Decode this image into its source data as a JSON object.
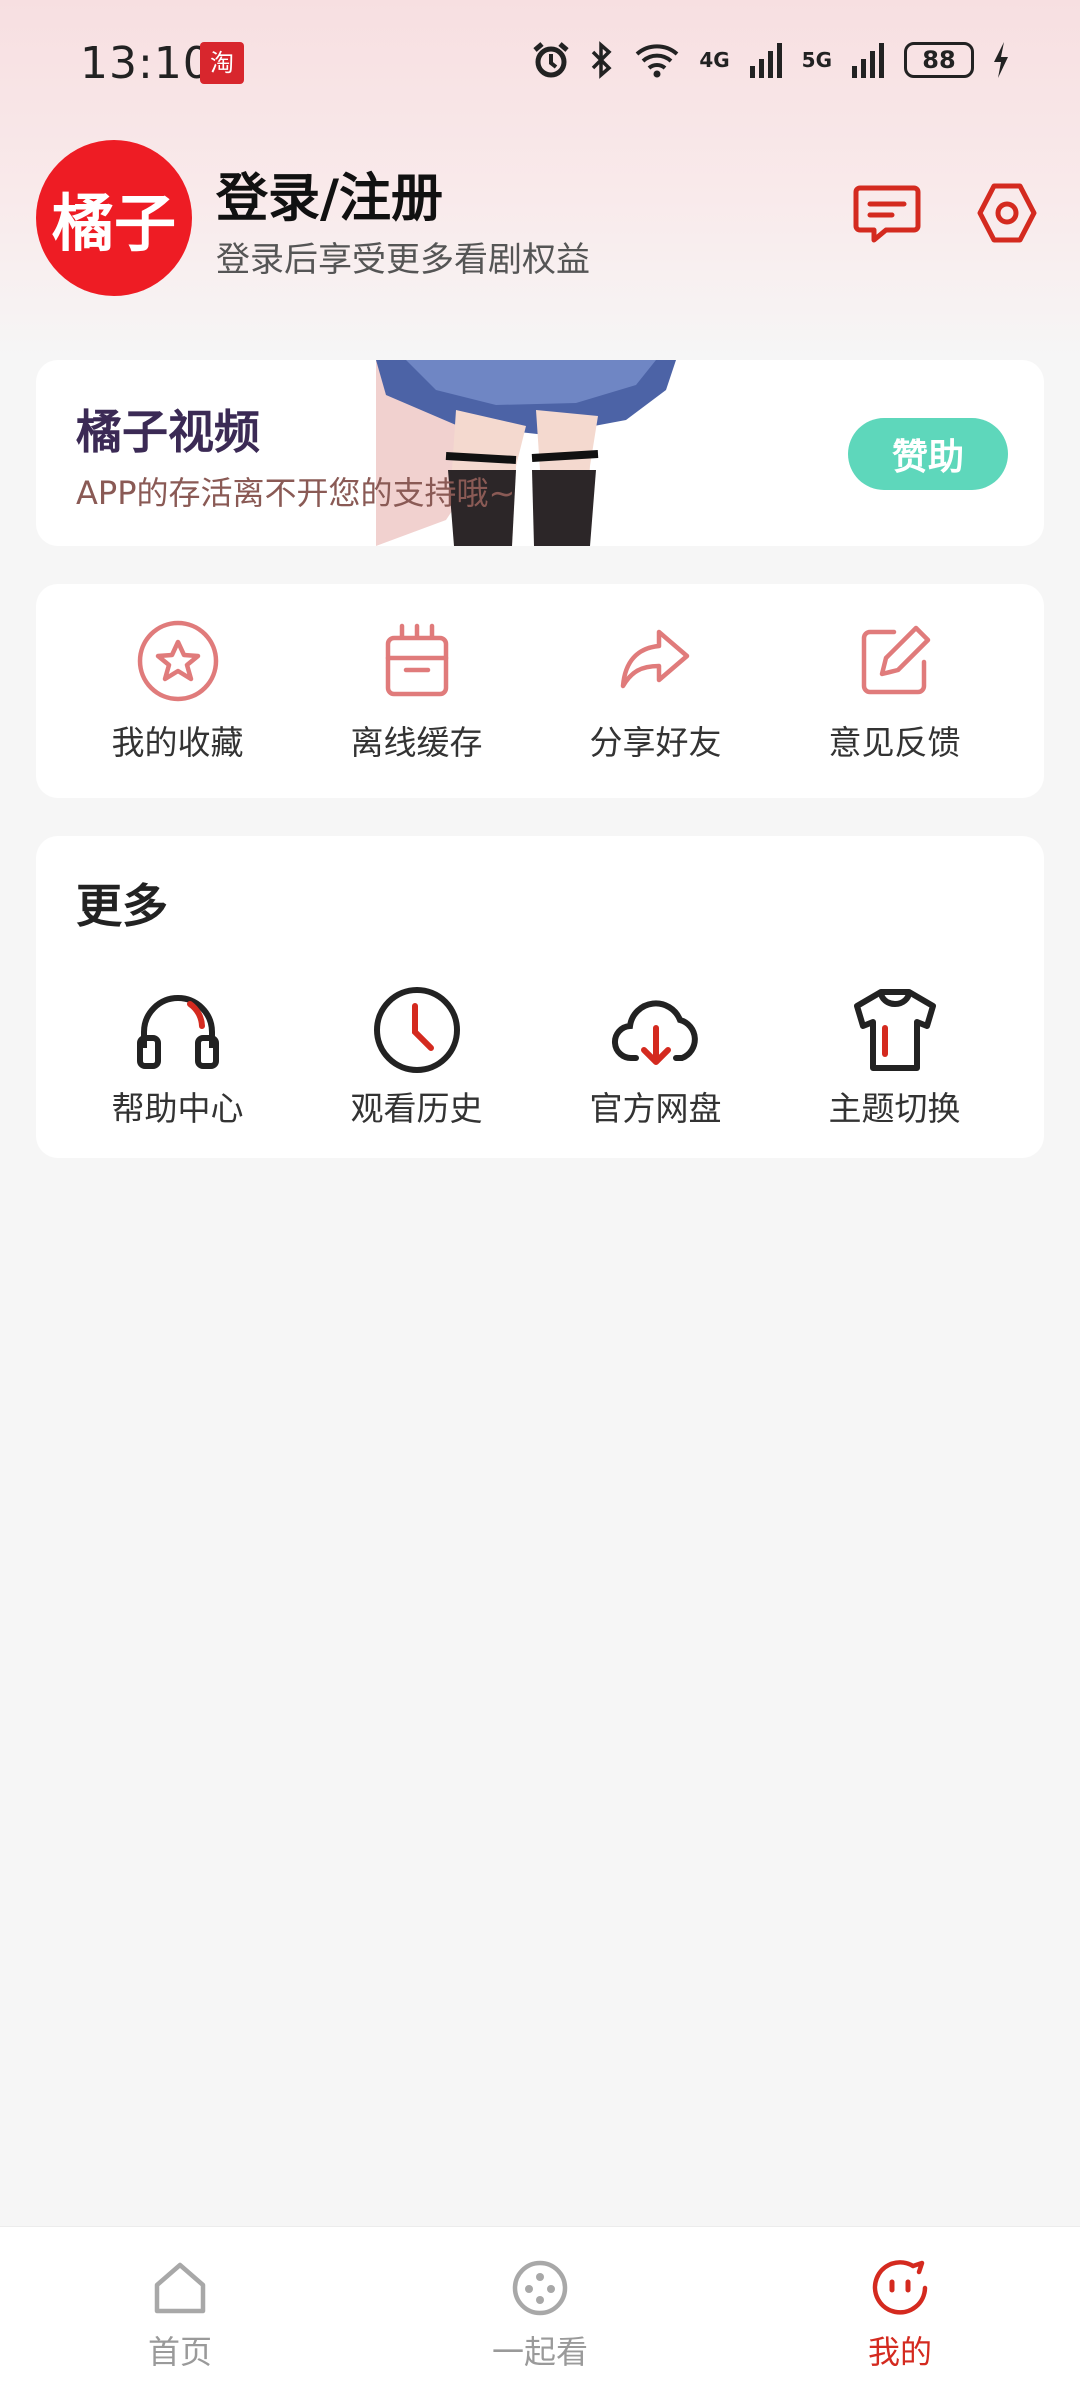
{
  "status_bar": {
    "time": "13:10",
    "app_badge": "淘",
    "net_4g": "4G",
    "net_5g": "5G",
    "battery": "88"
  },
  "profile": {
    "avatar_text": "橘子",
    "title": "登录/注册",
    "subtitle": "登录后享受更多看剧权益"
  },
  "sponsor": {
    "title": "橘子视频",
    "subtitle": "APP的存活离不开您的支持哦~",
    "button": "赞助"
  },
  "quick_actions": [
    {
      "label": "我的收藏",
      "icon": "star-icon"
    },
    {
      "label": "离线缓存",
      "icon": "cache-box-icon"
    },
    {
      "label": "分享好友",
      "icon": "share-icon"
    },
    {
      "label": "意见反馈",
      "icon": "edit-icon"
    }
  ],
  "more": {
    "title": "更多",
    "items": [
      {
        "label": "帮助中心",
        "icon": "headphones-icon"
      },
      {
        "label": "观看历史",
        "icon": "clock-icon"
      },
      {
        "label": "官方网盘",
        "icon": "cloud-download-icon"
      },
      {
        "label": "主题切换",
        "icon": "tshirt-icon"
      }
    ]
  },
  "bottom_nav": [
    {
      "label": "首页",
      "icon": "home-icon",
      "active": false
    },
    {
      "label": "一起看",
      "icon": "film-reel-icon",
      "active": false
    },
    {
      "label": "我的",
      "icon": "face-icon",
      "active": true
    }
  ],
  "colors": {
    "accent": "#d42a1f",
    "sponsor_button": "#5ed7bb",
    "icon_pink": "#e07b7b"
  }
}
